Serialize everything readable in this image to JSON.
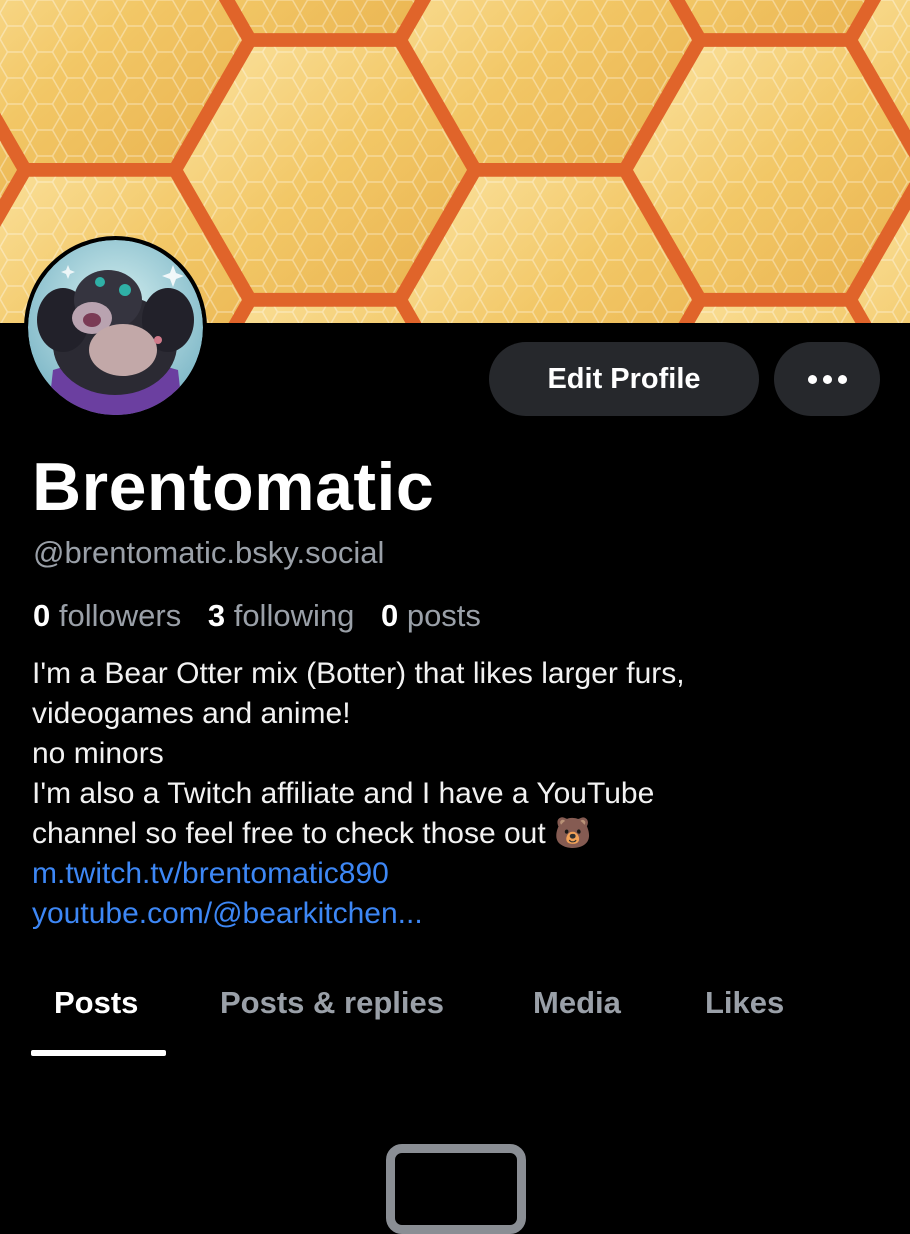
{
  "profile": {
    "display_name": "Brentomatic",
    "handle": "@brentomatic.bsky.social",
    "edit_profile_label": "Edit Profile",
    "more_icon": "more-horizontal-icon",
    "stats": {
      "followers_count": "0",
      "followers_label": "followers",
      "following_count": "3",
      "following_label": "following",
      "posts_count": "0",
      "posts_label": "posts"
    },
    "bio": {
      "line1": "I'm a Bear Otter mix (Botter) that likes larger furs,",
      "line2": "videogames and anime!",
      "line3": "no minors",
      "line4": "I'm also a Twitch affiliate and I have a YouTube",
      "line5": "channel so feel free to check those out 🐻",
      "link1": "m.twitch.tv/brentomatic890",
      "link2": "youtube.com/@bearkitchen..."
    }
  },
  "tabs": [
    {
      "label": "Posts",
      "active": true
    },
    {
      "label": "Posts & replies",
      "active": false
    },
    {
      "label": "Media",
      "active": false
    },
    {
      "label": "Likes",
      "active": false
    }
  ],
  "colors": {
    "background": "#000000",
    "link": "#3d87f5",
    "muted_text": "#9aa0a8",
    "button_bg": "#26282c",
    "banner_honey": "#f0c060",
    "banner_border": "#e0642a"
  }
}
